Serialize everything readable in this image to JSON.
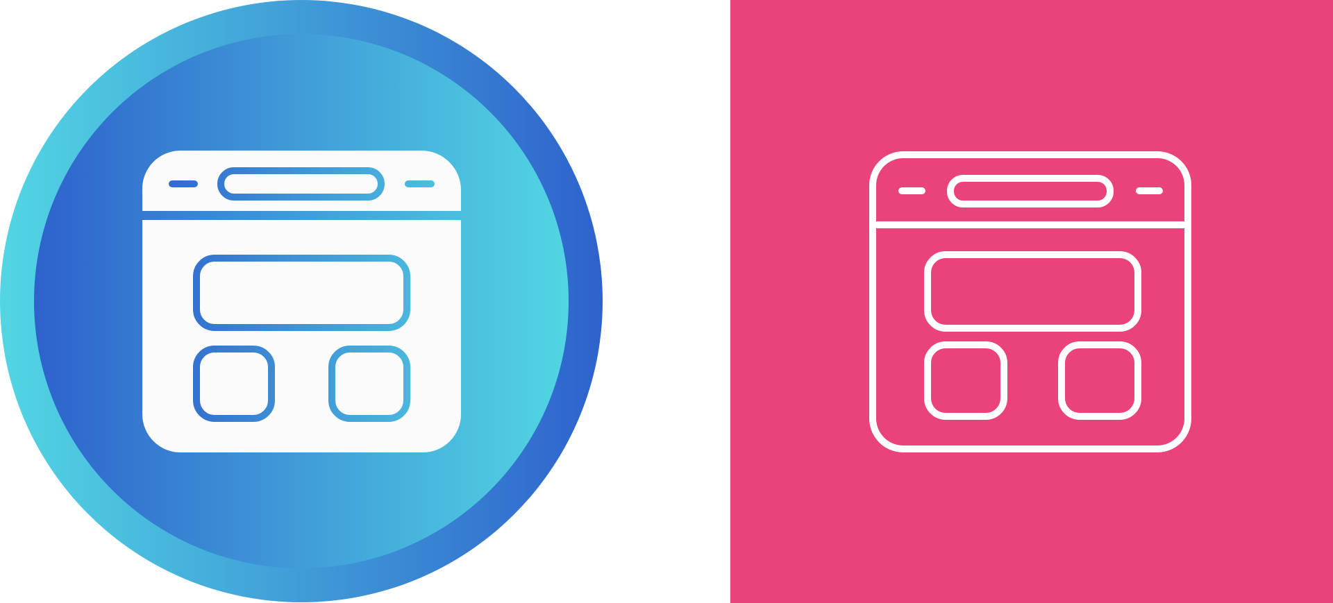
{
  "icons": [
    {
      "name": "web-layout-icon-gradient",
      "style": "glyph",
      "background": "circle-gradient"
    },
    {
      "name": "web-layout-icon-outline",
      "style": "line",
      "background": "square"
    }
  ],
  "colors": {
    "gradient_dark_blue": "#2e62cc",
    "gradient_light_cyan": "#52d6e3",
    "glyph_fill": "#fbfbfb",
    "pink_background": "#ea427a",
    "outline_stroke": "#ffffff"
  }
}
